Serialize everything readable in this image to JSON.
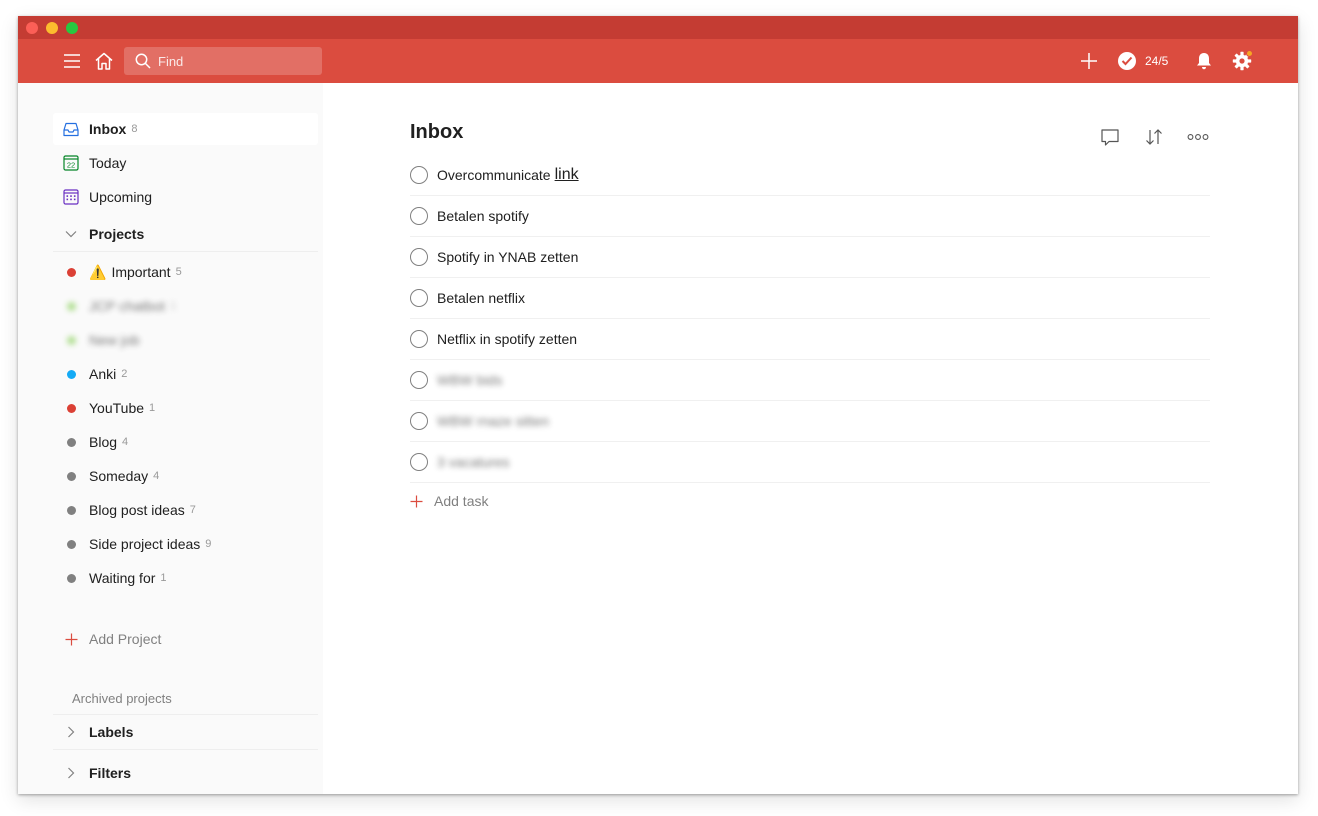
{
  "colors": {
    "brand": "#db4c3f",
    "titlebar": "#c43c33",
    "project_red": "#db4035",
    "project_green": "#7ecc49",
    "project_blue": "#14aaf5",
    "project_grey": "#808080",
    "upcoming_purple": "#692fc2",
    "today_green": "#058527",
    "inbox_blue": "#246fe0"
  },
  "topbar": {
    "menu_icon": "hamburger-icon",
    "home_icon": "home-icon",
    "search_placeholder": "Find",
    "add_icon": "plus-icon",
    "karma_icon": "checkmark-circle-icon",
    "karma_text": "24/5",
    "notifications_icon": "bell-icon",
    "settings_icon": "gear-icon"
  },
  "sidebar": {
    "nav": [
      {
        "label": "Inbox",
        "count": "8",
        "icon": "inbox-icon"
      },
      {
        "label": "Today",
        "count": "",
        "icon": "calendar-today-icon",
        "day": "22"
      },
      {
        "label": "Upcoming",
        "count": "",
        "icon": "calendar-upcoming-icon"
      }
    ],
    "projects_title": "Projects",
    "projects": [
      {
        "label": "Important",
        "count": "5",
        "emoji": "⚠️",
        "color": "red"
      },
      {
        "label": "JCP chatbot",
        "count": "1",
        "color": "green",
        "blurred": true
      },
      {
        "label": "New job",
        "count": "",
        "color": "green",
        "blurred": true
      },
      {
        "label": "Anki",
        "count": "2",
        "color": "blue"
      },
      {
        "label": "YouTube",
        "count": "1",
        "color": "red"
      },
      {
        "label": "Blog",
        "count": "4",
        "color": "grey"
      },
      {
        "label": "Someday",
        "count": "4",
        "color": "grey"
      },
      {
        "label": "Blog post ideas",
        "count": "7",
        "color": "grey"
      },
      {
        "label": "Side project ideas",
        "count": "9",
        "color": "grey"
      },
      {
        "label": "Waiting for",
        "count": "1",
        "color": "grey"
      }
    ],
    "add_project": "Add Project",
    "archived": "Archived projects",
    "labels_title": "Labels",
    "filters_title": "Filters"
  },
  "main": {
    "title": "Inbox",
    "actions": [
      "comment-icon",
      "sort-icon",
      "more-icon"
    ],
    "tasks": [
      {
        "text": "Overcommunicate",
        "link": "link"
      },
      {
        "text": "Betalen spotify"
      },
      {
        "text": "Spotify in YNAB zetten"
      },
      {
        "text": "Betalen netflix"
      },
      {
        "text": "Netflix in spotify zetten"
      },
      {
        "text": "WBW bids",
        "blurred": true
      },
      {
        "text": "WBW rnaze sitten",
        "blurred": true
      },
      {
        "text": "3 vacatures",
        "blurred": true
      }
    ],
    "add_task": "Add task"
  }
}
